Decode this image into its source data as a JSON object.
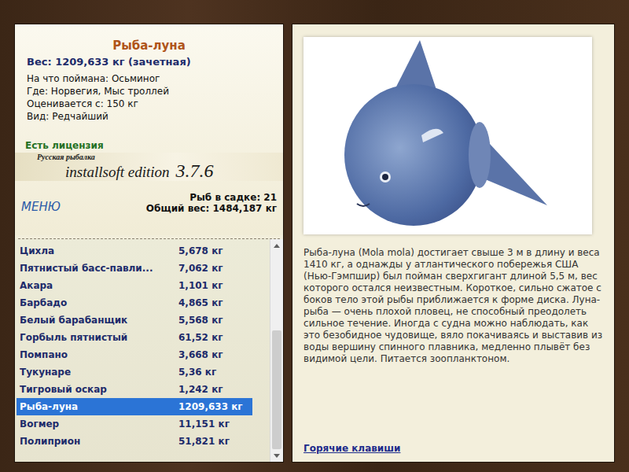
{
  "fish": {
    "title": "Рыба-луна",
    "weight": "Вес: 1209,633 кг (зачетная)",
    "details": [
      "На что поймана: Осьминог",
      "Где: Норвегия, Мыс троллей",
      "Оценивается с: 150 кг",
      "Вид: Редчайший"
    ],
    "license": "Есть лицензия"
  },
  "logo": {
    "brand": "Русская рыбалка",
    "edition": "installsoft edition",
    "version": "3.7.6"
  },
  "menu": "МЕНЮ",
  "keepnet": {
    "count": "Рыб в садке: 21",
    "total": "Общий вес: 1484,187 кг"
  },
  "catch_list": {
    "items": [
      {
        "name": "Цихла",
        "weight": "5,678 кг",
        "selected": false
      },
      {
        "name": "Пятнистый басс-павли...",
        "weight": "7,062 кг",
        "selected": false
      },
      {
        "name": "Акара",
        "weight": "1,101 кг",
        "selected": false
      },
      {
        "name": "Барбадо",
        "weight": "4,865 кг",
        "selected": false
      },
      {
        "name": "Белый барабанщик",
        "weight": "5,568 кг",
        "selected": false
      },
      {
        "name": "Горбыль пятнистый",
        "weight": "61,52 кг",
        "selected": false
      },
      {
        "name": "Помпано",
        "weight": "3,668 кг",
        "selected": false
      },
      {
        "name": "Тукунаре",
        "weight": "5,36 кг",
        "selected": false
      },
      {
        "name": "Тигровый оскар",
        "weight": "1,242 кг",
        "selected": false
      },
      {
        "name": "Рыба-луна",
        "weight": "1209,633 кг",
        "selected": true
      },
      {
        "name": "Вогмер",
        "weight": "11,151 кг",
        "selected": false
      },
      {
        "name": "Полиприон",
        "weight": "51,821 кг",
        "selected": false
      }
    ],
    "scrollbar": {
      "level": 1
    }
  },
  "description": "Рыба-луна (Mola mola) достигает свыше 3 м в длину и веса 1410 кг, а однажды у атлантического побережья США (Нью-Гэмпшир) был пойман сверхгигант длиной 5,5 м, вес которого остался неизвестным. Короткое, сильно сжатое с боков тело этой рыбы приближается к форме диска. Луна-рыба — очень плохой пловец, не способный преодолеть сильное течение. Иногда с судна можно наблюдать, как это безобидное чудовище, вяло покачиваясь и выставив из воды вершину спинного плавника, медленно плывёт без видимой цели. Питается зоопланктоном.",
  "hotkeys_link": "Горячие клавиши"
}
